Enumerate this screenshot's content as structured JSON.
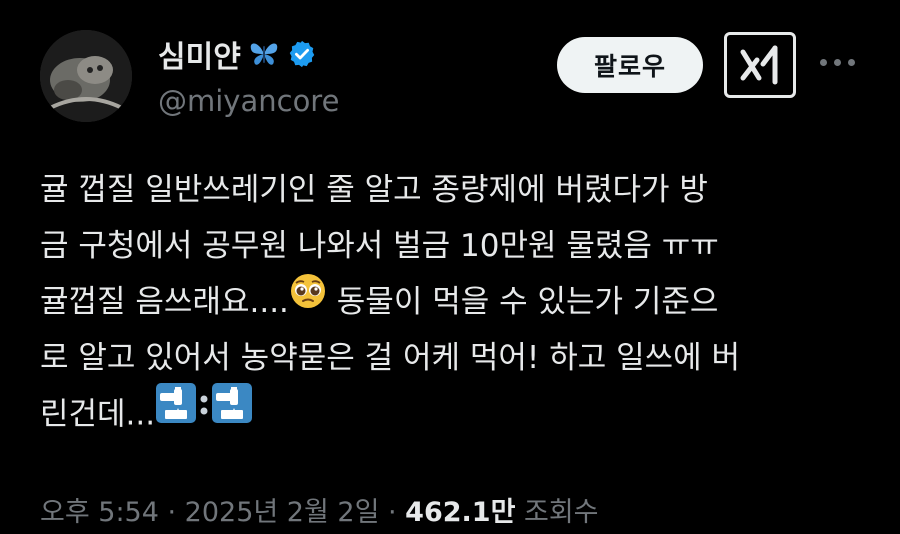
{
  "author": {
    "name": "심미얀",
    "handle": "@miyancore",
    "name_emoji": "butterfly-icon",
    "verified": true,
    "verified_color": "#1d9bf0"
  },
  "actions": {
    "follow_label": "팔로우",
    "grok_icon": "grok-icon",
    "more_icon": "more-icon"
  },
  "tweet": {
    "lines": [
      "귤 껍질 일반쓰레기인 줄 알고 종량제에 버렸다가 방",
      "금 구청에서 공무원 나와서 벌금 10만원 물렸음 ㅠㅠ",
      "귤껍질 음쓰래요....",
      " 동물이 먹을 수 있는가 기준으",
      "로 알고 있어서 농약묻은 걸 어케 먹어! 하고 일쓰에 버",
      "린건데..."
    ],
    "emojis": [
      "pleading-face-icon",
      "potable-water-icon",
      "potable-water-icon"
    ]
  },
  "meta": {
    "time": "오후 5:54",
    "sep1": " · ",
    "date": "2025년 2월 2일",
    "sep2": " · ",
    "views": "462.1만",
    "views_label": " 조회수"
  }
}
